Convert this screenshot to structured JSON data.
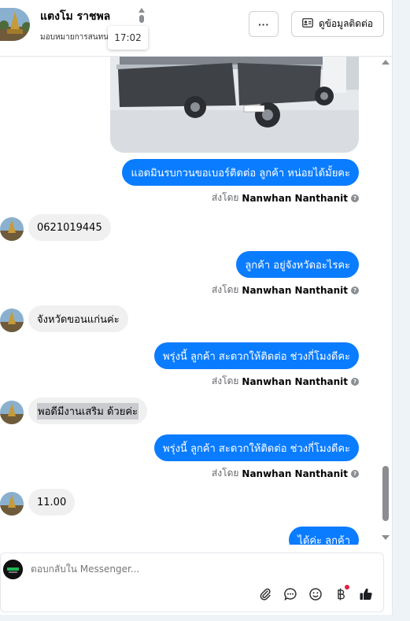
{
  "header": {
    "name": "แตงโม ราชพล",
    "subtitle": "มอบหมายการสนทนา",
    "tooltip_time": "17:02",
    "more_label": "···",
    "contact_label": "ดูข้อมูลติดต่อ"
  },
  "messages": {
    "m1": "แอดมินรบกวนขอเบอร์ติดต่อ ลูกค้า หน่อยได้มั้ยคะ",
    "sent_prefix": "ส่งโดย",
    "sender": "Nanwhan Nanthanit",
    "m2": "0621019445",
    "m3": "ลูกค้า อยู่จังหวัดอะไรคะ",
    "m4": "จังหวัดขอนแก่นค่ะ",
    "m5": "พรุ่งนี้ ลูกค้า สะดวกให้ติดต่อ ช่วงกี่โมงดีคะ",
    "m6": "พอดีมีงานเสริม ด้วยค่ะ",
    "m7": "พรุ่งนี้ ลูกค้า สะดวกให้ติดต่อ ช่วงกี่โมงดีคะ",
    "m8": "11.00",
    "m9": "ได้ค่ะ ลูกค้า"
  },
  "composer": {
    "placeholder": "ตอบกลับใน Messenger..."
  },
  "icons": {
    "attach": "paperclip-icon",
    "chat": "chat-bubble-icon",
    "emoji": "smiley-icon",
    "currency": "baht-icon",
    "like": "thumbs-up-icon"
  },
  "colors": {
    "outgoing_bubble": "#0a7cff",
    "incoming_bubble": "#f0f0f0",
    "notification_dot": "#e41e3f"
  }
}
